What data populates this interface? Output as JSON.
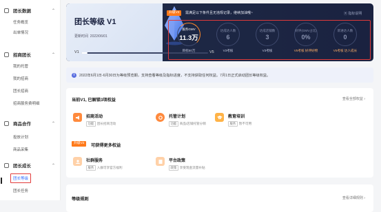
{
  "sidebar": {
    "groups": [
      {
        "label": "团长数据",
        "items": [
          "任务概览",
          "出单情况"
        ]
      },
      {
        "label": "招商团长",
        "items": [
          "我的托管",
          "我的招商",
          "团长招商",
          "招商服务费明细"
        ]
      },
      {
        "label": "商品合作",
        "items": [
          "投放计划",
          "商品采集"
        ]
      },
      {
        "label": "团长成长",
        "items": [
          "团长等级",
          "团长任务"
        ]
      }
    ],
    "active_item": "团长等级"
  },
  "hero": {
    "title": "团长等级 V1",
    "date_label": "更新时间",
    "date": "2022/06/01",
    "level_min": "V1",
    "level_max": "V5",
    "progress": 0.05,
    "upgrade_tag": "升级V2",
    "upgrade_msg": "需满足以下条件且无违规记录，继续加油哦~",
    "indicator_link": "指标说明",
    "metrics": [
      {
        "label": "服务GMV",
        "value": "11.3万",
        "sub": "目标50万",
        "warn": false,
        "highlight": true
      },
      {
        "label": "达成达人数",
        "value": "6",
        "sub": "V3考核",
        "warn": false,
        "highlight": false
      },
      {
        "label": "达成店铺数",
        "value": "3",
        "sub": "V3考核",
        "warn": false,
        "highlight": false
      },
      {
        "label": "好评(GMV占比)",
        "value": "0%",
        "sub": "V5考核 好评好物",
        "warn": true,
        "highlight": false
      },
      {
        "label": "新进达人数",
        "value": "0",
        "sub": "V5考核 达人成长",
        "warn": true,
        "highlight": false
      }
    ]
  },
  "notice": {
    "icon": "info-icon",
    "text": "2022年6月1日-6月30日为等级预览期，支持查看等级及指标进度，不支持获取任何权益。7月1日正式启动团长等级权益。"
  },
  "benefits": {
    "title": "当前V1, 已解锁3项权益",
    "link": "查看全部权益",
    "current": [
      {
        "name": "招商活动",
        "tag": "功能",
        "desc": "团长招商活动",
        "icon": "megaphone-icon",
        "color": "#ff8a3d"
      },
      {
        "name": "托管计划",
        "tag": "功能",
        "desc": "商品/店铺托管分销",
        "icon": "gear-icon",
        "color": "#ff8a3d"
      },
      {
        "name": "教育培训",
        "tag": "服务",
        "desc": "暂不可用",
        "icon": "graduation-cap-icon",
        "color": "#ffb347"
      }
    ],
    "next_tag": "升级V2",
    "next_title": "可获得更多权益",
    "next": [
      {
        "name": "社群服务",
        "tag": "服务",
        "desc": "入群可享官方福利",
        "icon": "community-icon",
        "color": "#ffd1a8"
      },
      {
        "name": "平台政策",
        "tag": "政策",
        "desc": "享受现金流量补贴",
        "icon": "document-icon",
        "color": "#ffd1a8"
      }
    ]
  },
  "rules": {
    "title": "等级规则",
    "link": "查看详细规则"
  }
}
